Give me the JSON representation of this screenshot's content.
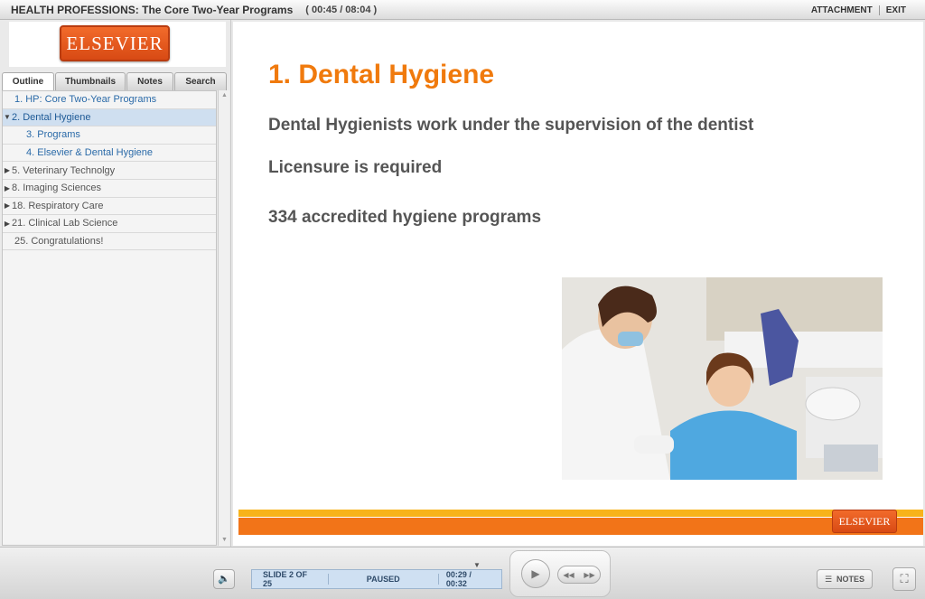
{
  "header": {
    "title": "HEALTH PROFESSIONS: The Core Two-Year Programs",
    "time": "( 00:45 / 08:04 )",
    "attachment": "ATTACHMENT",
    "exit": "EXIT"
  },
  "sidebar": {
    "logo": "ELSEVIER",
    "tabs": [
      "Outline",
      "Thumbnails",
      "Notes",
      "Search"
    ],
    "outline": [
      {
        "label": "1. HP: Core Two-Year Programs",
        "arrow": "",
        "indent": 1,
        "link": true
      },
      {
        "label": "2. Dental Hygiene",
        "arrow": "▼",
        "indent": 0,
        "link": true,
        "selected": true
      },
      {
        "label": "3. Programs",
        "arrow": "",
        "indent": 2,
        "link": true
      },
      {
        "label": "4. Elsevier & Dental Hygiene",
        "arrow": "",
        "indent": 2,
        "link": true
      },
      {
        "label": "5. Veterinary Technolgy",
        "arrow": "▶",
        "indent": 0,
        "link": false
      },
      {
        "label": "8. Imaging Sciences",
        "arrow": "▶",
        "indent": 0,
        "link": false
      },
      {
        "label": "18. Respiratory Care",
        "arrow": "▶",
        "indent": 0,
        "link": false
      },
      {
        "label": "21. Clinical Lab Science",
        "arrow": "▶",
        "indent": 0,
        "link": false
      },
      {
        "label": "25. Congratulations!",
        "arrow": "",
        "indent": 1,
        "link": false
      }
    ]
  },
  "slide": {
    "title": "1. Dental Hygiene",
    "bullets": [
      "Dental Hygienists work under the supervision of the dentist",
      "Licensure is required",
      "334 accredited hygiene programs"
    ],
    "footer_logo": "ELSEVIER"
  },
  "player": {
    "slide_counter": "SLIDE 2 OF 25",
    "state": "PAUSED",
    "elapsed": "00:29 / 00:32",
    "notes": "NOTES"
  },
  "colors": {
    "accent_orange": "#f07a0d",
    "footer_yellow": "#f7b31b",
    "footer_orange": "#f27418"
  }
}
